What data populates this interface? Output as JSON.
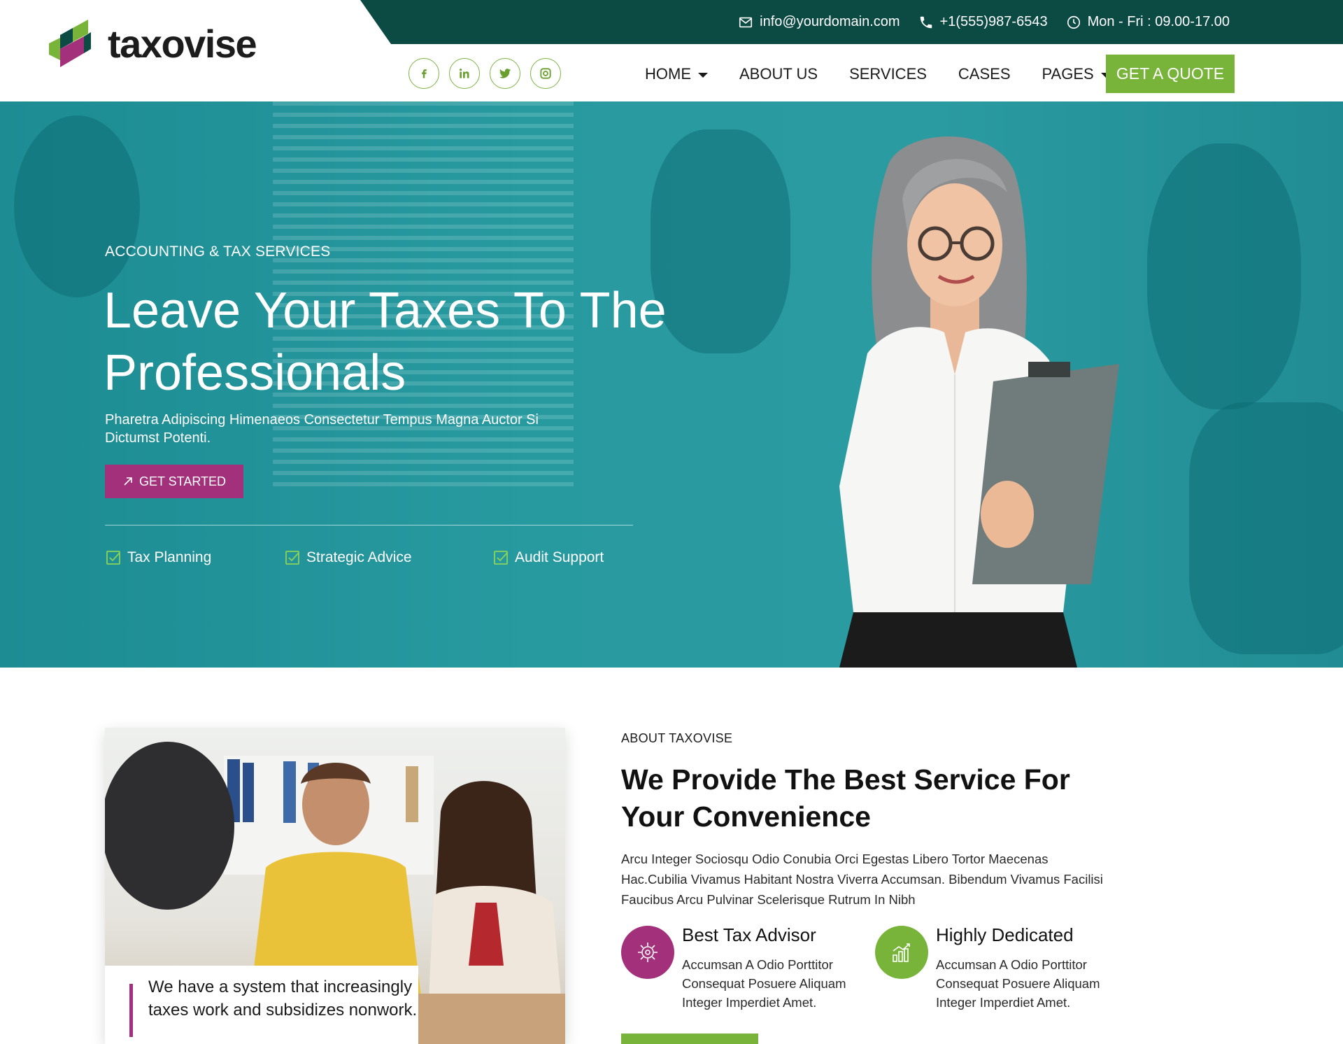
{
  "header": {
    "logo_text": "taxovise",
    "topbar": {
      "email": "info@yourdomain.com",
      "phone": "+1(555)987-6543",
      "hours": "Mon - Fri : 09.00-17.00"
    },
    "socials": [
      "facebook-icon",
      "linkedin-icon",
      "twitter-icon",
      "instagram-icon"
    ],
    "nav": {
      "home": "HOME",
      "about": "ABOUT US",
      "services": "SERVICES",
      "cases": "CASES",
      "pages": "PAGES",
      "quote": "GET A QUOTE"
    }
  },
  "hero": {
    "eyebrow": "ACCOUNTING & TAX SERVICES",
    "title": "Leave Your Taxes To The Professionals",
    "subtitle": "Pharetra Adipiscing Himenaeos Consectetur Tempus Magna Auctor Si Dictumst Potenti.",
    "cta": "GET STARTED",
    "features": [
      "Tax Planning",
      "Strategic Advice",
      "Audit Support"
    ]
  },
  "about": {
    "photo_caption": "We have a system that increasingly taxes work and subsidizes nonwork.",
    "eyebrow": "ABOUT TAXOVISE",
    "title": "We Provide The Best Service For Your Convenience",
    "text": "Arcu Integer Sociosqu Odio Conubia Orci Egestas Libero Tortor Maecenas Hac.Cubilia Vivamus Habitant Nostra Viverra Accumsan. Bibendum Vivamus Facilisi Faucibus Arcu Pulvinar Scelerisque Rutrum In Nibh",
    "advantages": [
      {
        "title": "Best Tax Advisor",
        "text": "Accumsan A Odio Porttitor Consequat Posuere Aliquam Integer Imperdiet Amet.",
        "icon": "brain-gear-icon",
        "color": "#a3307b"
      },
      {
        "title": "Highly Dedicated",
        "text": "Accumsan A Odio Porttitor Consequat Posuere Aliquam Integer Imperdiet Amet.",
        "icon": "growth-chart-icon",
        "color": "#79b43a"
      }
    ]
  },
  "colors": {
    "dark_teal": "#0c4a44",
    "hero_teal": "#279aa0",
    "green": "#79b43a",
    "magenta": "#a3307b"
  }
}
